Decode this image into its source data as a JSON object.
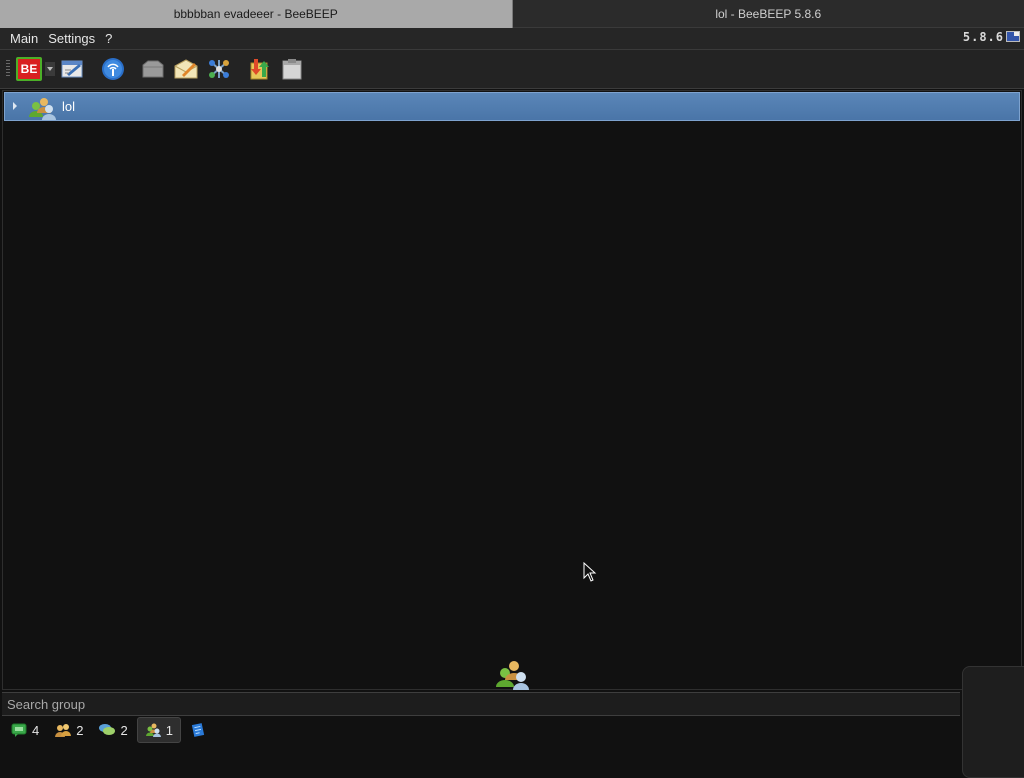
{
  "window_tabs": [
    {
      "label": "bbbbban evadeeer - BeeBEEP"
    },
    {
      "label": "lol - BeeBEEP 5.8.6"
    }
  ],
  "menu": {
    "items": [
      "Main",
      "Settings",
      "?"
    ],
    "version": "5.8.6"
  },
  "toolbar": {
    "logo_text": "BE",
    "icons": [
      "beebeep-logo-icon",
      "profile-edit-icon",
      "broadcast-icon",
      "folder-icon",
      "write-message-icon",
      "network-icon",
      "file-transfer-icon",
      "clipboard-icon"
    ]
  },
  "groups": [
    {
      "name": "lol",
      "icon": "group-users-icon"
    }
  ],
  "search": {
    "placeholder": "Search group",
    "value": ""
  },
  "view_tabs": [
    {
      "icon": "users-chat-icon",
      "count": "4"
    },
    {
      "icon": "users-icon",
      "count": "2"
    },
    {
      "icon": "chat-bubbles-icon",
      "count": "2"
    },
    {
      "icon": "group-icon",
      "count": "1",
      "selected": true
    },
    {
      "icon": "notes-icon",
      "count": ""
    }
  ],
  "colors": {
    "selection": "#4a75a8",
    "background": "#111111",
    "active_tab": "#a9a9a9"
  }
}
